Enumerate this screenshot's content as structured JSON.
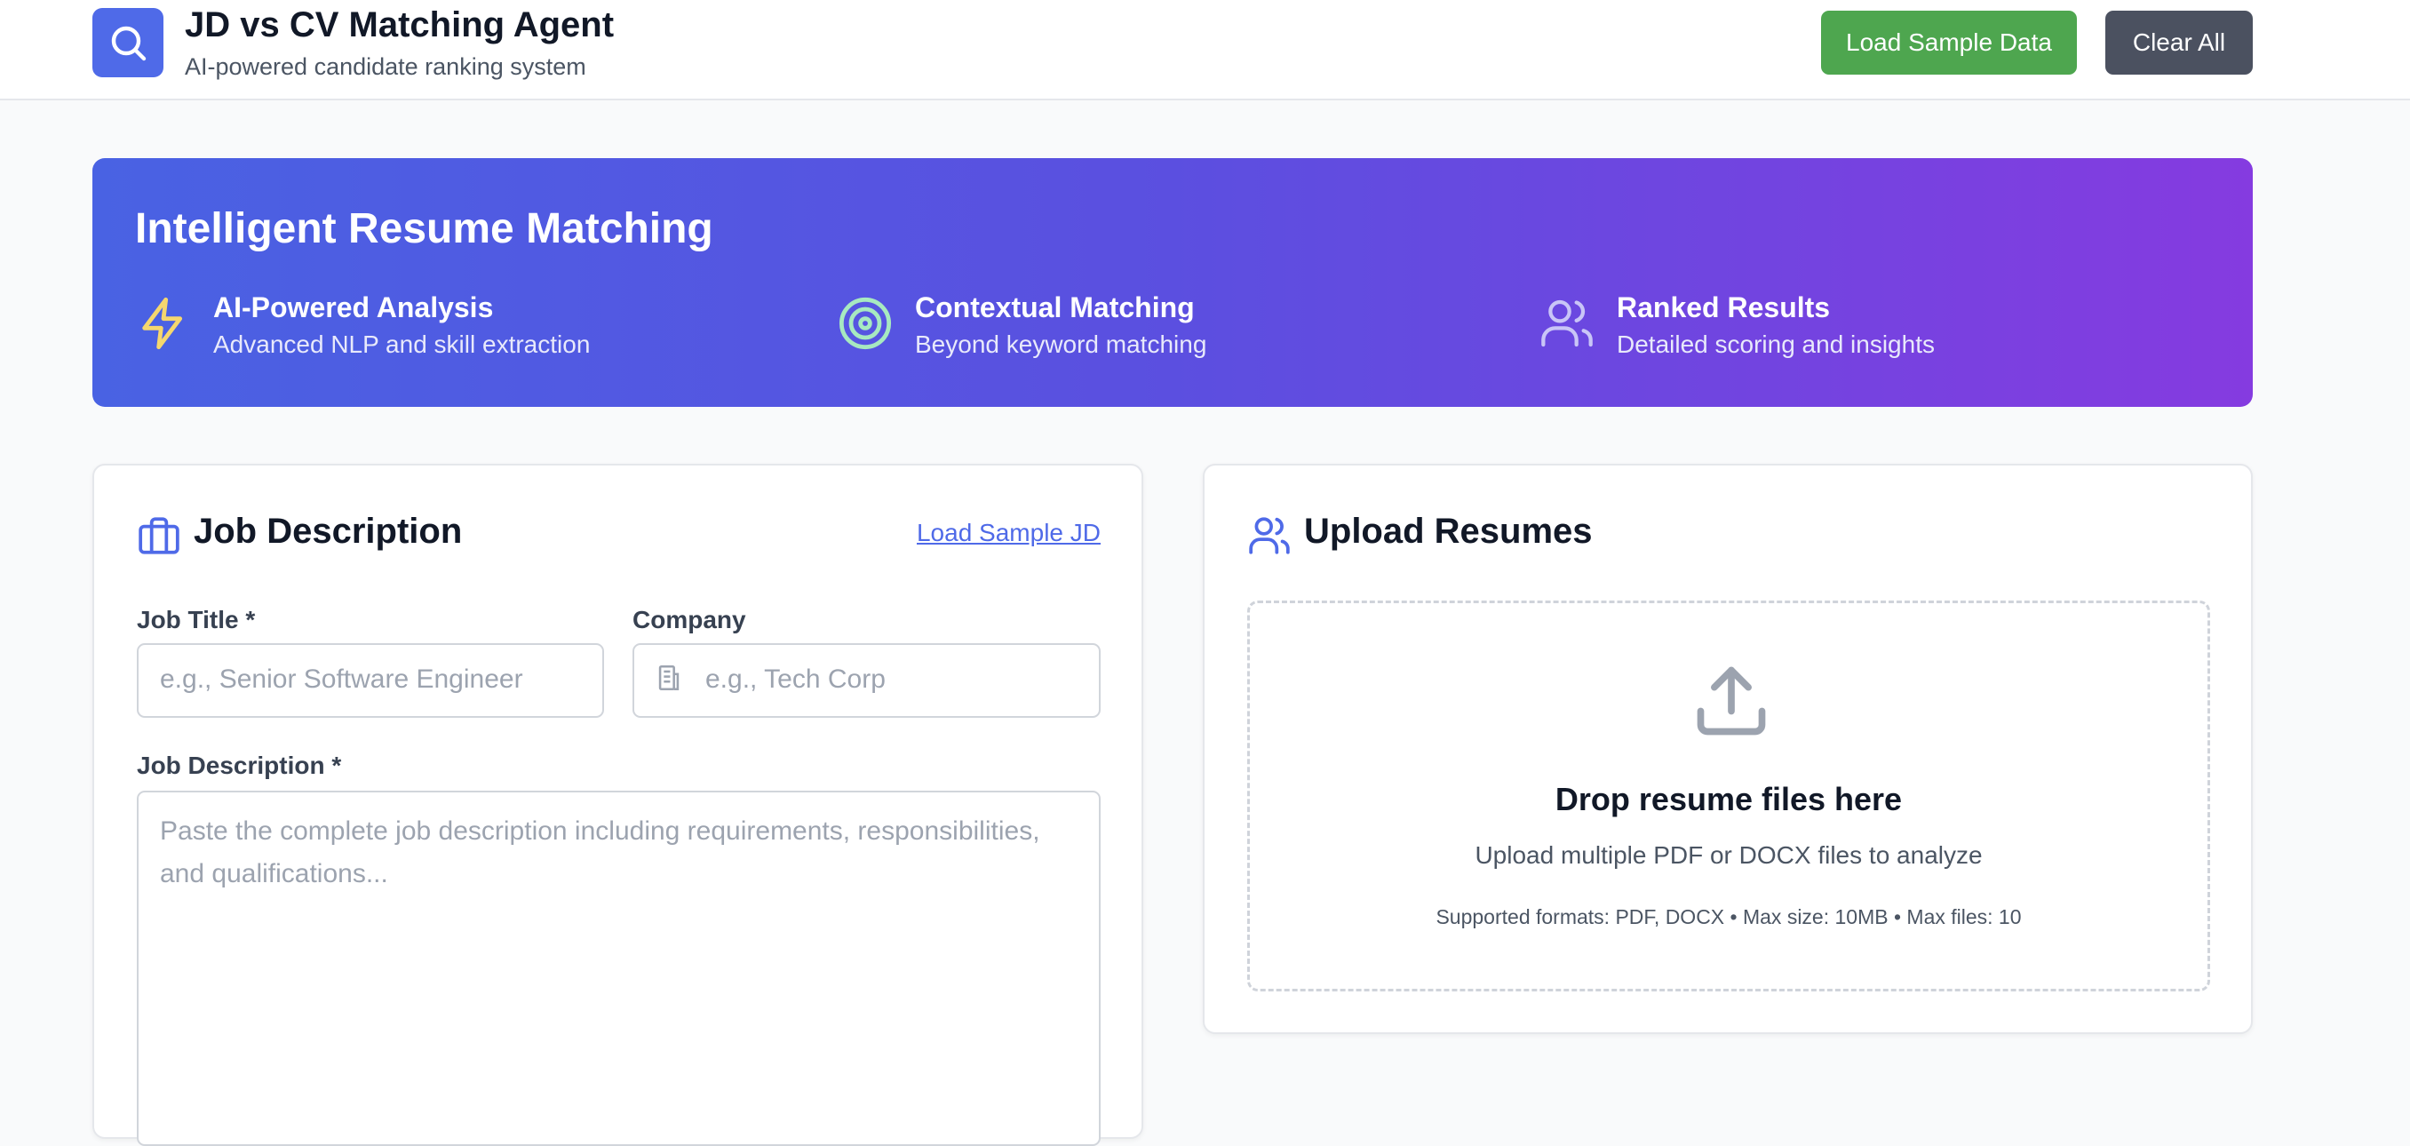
{
  "header": {
    "title": "JD vs CV Matching Agent",
    "subtitle": "AI-powered candidate ranking system",
    "load_sample_label": "Load Sample Data",
    "clear_all_label": "Clear All",
    "logo_icon": "search-icon",
    "accent_color": "#4f6ae8"
  },
  "hero": {
    "title": "Intelligent Resume Matching",
    "features": [
      {
        "icon": "lightning-icon",
        "name": "AI-Powered Analysis",
        "desc": "Advanced NLP and skill extraction"
      },
      {
        "icon": "target-icon",
        "name": "Contextual Matching",
        "desc": "Beyond keyword matching"
      },
      {
        "icon": "users-icon",
        "name": "Ranked Results",
        "desc": "Detailed scoring and insights"
      }
    ]
  },
  "job_description": {
    "title": "Job Description",
    "load_sample_label": "Load Sample JD",
    "job_title_label": "Job Title *",
    "job_title_placeholder": "e.g., Senior Software Engineer",
    "company_label": "Company",
    "company_placeholder": "e.g., Tech Corp",
    "description_label": "Job Description *",
    "description_placeholder": "Paste the complete job description including requirements, responsibilities, and qualifications..."
  },
  "upload": {
    "title": "Upload Resumes",
    "drop_title": "Drop resume files here",
    "drop_subtitle": "Upload multiple PDF or DOCX files to analyze",
    "drop_note": "Supported formats: PDF, DOCX • Max size: 10MB • Max files: 10"
  }
}
